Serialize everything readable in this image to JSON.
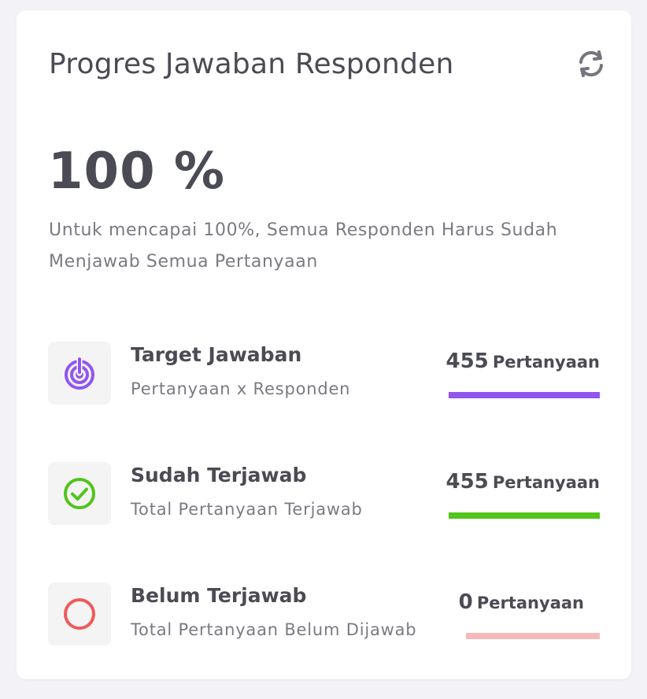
{
  "card": {
    "title": "Progres Jawaban Responden",
    "percent": "100 %",
    "description": "Untuk mencapai 100%, Semua Responden Harus Sudah Menjawab Semua Pertanyaan"
  },
  "icons": {
    "refresh": "refresh-icon",
    "target": "target-icon",
    "answered": "check-circle-icon",
    "unanswered": "circle-icon"
  },
  "colors": {
    "target": "#9155f0",
    "answered": "#52c41a",
    "unanswered_icon": "#ef5a5a",
    "unanswered_bar": "#f6b9bb"
  },
  "rows": [
    {
      "title": "Target Jawaban",
      "subtitle": "Pertanyaan x Responden",
      "value": "455",
      "unit": "Pertanyaan"
    },
    {
      "title": "Sudah Terjawab",
      "subtitle": "Total Pertanyaan Terjawab",
      "value": "455",
      "unit": "Pertanyaan"
    },
    {
      "title": "Belum Terjawab",
      "subtitle": "Total Pertanyaan Belum Dijawab",
      "value": "0",
      "unit": "Pertanyaan"
    }
  ]
}
